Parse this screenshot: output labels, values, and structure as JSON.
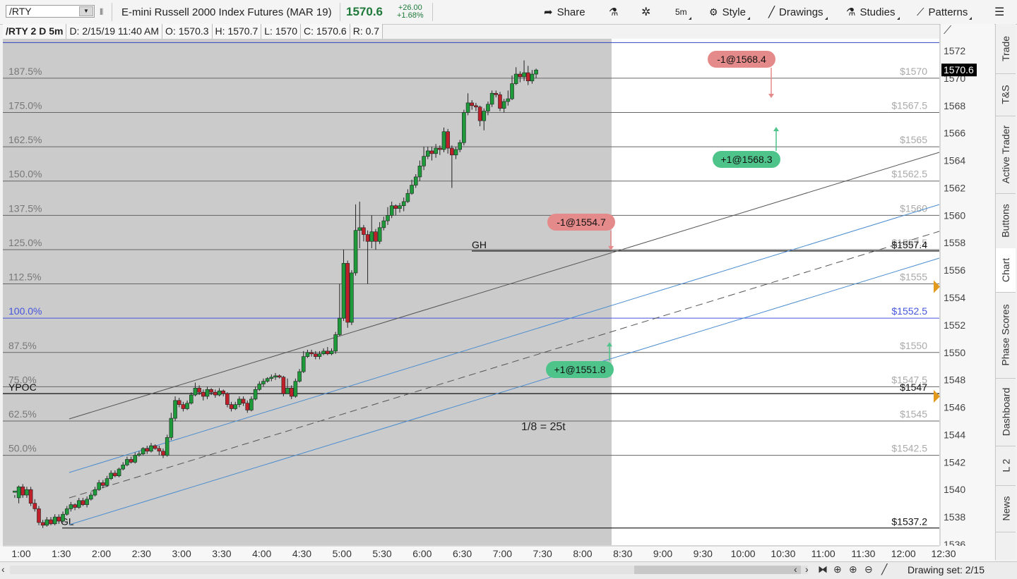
{
  "toolbar": {
    "symbol": "/RTY",
    "description": "E-mini Russell 2000 Index Futures (MAR 19)",
    "last": "1570.6",
    "change": "+26.00",
    "change_pct": "+1.68%",
    "share": "Share",
    "interval": "5m",
    "style": "Style",
    "drawings": "Drawings",
    "studies": "Studies",
    "patterns": "Patterns"
  },
  "infobar": {
    "symbol": "/RTY 2 D 5m",
    "date": "D: 2/15/19 11:40 AM",
    "open": "O: 1570.3",
    "high": "H: 1570.7",
    "low": "L: 1570",
    "close": "C: 1570.6",
    "range": "R: 0.7"
  },
  "chart_data": {
    "type": "candlestick",
    "title": "",
    "x_labels": [
      "1:00",
      "1:30",
      "2:00",
      "2:30",
      "3:00",
      "3:30",
      "4:00",
      "4:30",
      "5:00",
      "5:30",
      "6:00",
      "6:30",
      "7:00",
      "7:30",
      "8:00",
      "8:30",
      "9:00",
      "9:30",
      "10:00",
      "10:30",
      "11:00",
      "11:30",
      "12:00",
      "12:30"
    ],
    "y_ticks": [
      1536,
      1538,
      1540,
      1542,
      1544,
      1546,
      1548,
      1550,
      1552,
      1554,
      1556,
      1558,
      1560,
      1562,
      1564,
      1566,
      1568,
      1570,
      1572
    ],
    "ylim": [
      1535.7,
      1573.3
    ],
    "last_price": "1570.6",
    "levels": [
      {
        "pct": "187.5%",
        "price": "$1570",
        "value": 1570
      },
      {
        "pct": "175.0%",
        "price": "$1567.5",
        "value": 1567.5
      },
      {
        "pct": "162.5%",
        "price": "$1565",
        "value": 1565
      },
      {
        "pct": "150.0%",
        "price": "$1562.5",
        "value": 1562.5
      },
      {
        "pct": "137.5%",
        "price": "$1560",
        "value": 1560
      },
      {
        "pct": "125.0%",
        "price": "$1557.5",
        "value": 1557.5
      },
      {
        "pct": "112.5%",
        "price": "$1555",
        "value": 1555
      },
      {
        "pct": "100.0%",
        "price": "$1552.5",
        "value": 1552.5
      },
      {
        "pct": "87.5%",
        "price": "$1550",
        "value": 1550
      },
      {
        "pct": "75.0%",
        "price": "$1547.5",
        "value": 1547.5
      },
      {
        "pct": "62.5%",
        "price": "$1545",
        "value": 1545
      },
      {
        "pct": "50.0%",
        "price": "$1542.5",
        "value": 1542.5
      }
    ],
    "special_levels": [
      {
        "label": "GH",
        "price": "$1557.4",
        "value": 1557.4
      },
      {
        "label": "YPOC",
        "price": "$1547",
        "value": 1547
      },
      {
        "label": "GL",
        "price": "$1537.2",
        "value": 1537.2
      }
    ],
    "annotation": "1/8 = 25t",
    "trades": [
      {
        "label": "-1@1568.4",
        "side": "sell",
        "t": 10.67,
        "price": 1568.4
      },
      {
        "label": "+1@1568.3",
        "side": "buy",
        "t": 10.75,
        "price": 1566.6
      },
      {
        "label": "-1@1554.7",
        "side": "sell",
        "t": 8.3,
        "price": 1557.3
      },
      {
        "label": "+1@1551.8",
        "side": "buy",
        "t": 8.3,
        "price": 1550.9
      }
    ],
    "candles_compact": "0.92,1539.8,1539.9,1539.6,1539.4 0.97,1539.4,1540.2,1540.3,1539.0 1.02,1540.2,1539.6,1540.4,1539.4 1.07,1539.6,1540.0,1540.2,1539.4 1.12,1540.0,1539.0,1540.2,1538.8 1.17,1539.0,1538.6,1539.3,1538.4 1.22,1538.6,1537.6,1538.8,1537.4 1.27,1537.6,1537.4,1537.8,1537.2 1.32,1537.4,1537.8,1538.0,1537.3 1.37,1537.8,1537.5,1538.0,1537.4 1.42,1537.5,1538.0,1538.2,1537.4 1.47,1538.0,1537.7,1538.2,1537.5 1.52,1537.7,1538.2,1538.4,1537.6 1.57,1538.2,1538.6,1538.8,1538.1 1.62,1538.6,1538.9,1539.1,1538.4 1.67,1538.9,1538.7,1539.0,1538.5 1.72,1538.7,1539.2,1539.4,1538.6 1.77,1539.2,1538.9,1539.4,1538.8 1.82,1538.9,1539.3,1539.5,1538.7 1.87,1539.3,1539.6,1539.8,1539.2 1.92,1539.6,1540.0,1540.2,1539.5 1.97,1540.0,1540.5,1540.7,1539.9 2.02,1540.5,1540.3,1540.7,1540.1 2.07,1540.3,1540.8,1541.0,1540.2 2.12,1540.8,1541.2,1541.4,1540.7 2.17,1541.2,1541.0,1541.4,1540.9 2.22,1541.0,1541.5,1541.6,1540.9 2.27,1541.5,1541.8,1542.0,1541.4 2.32,1541.8,1542.2,1542.4,1541.7 2.37,1542.2,1542.0,1542.4,1541.9 2.42,1542.0,1542.5,1542.7,1541.9 2.47,1542.5,1542.6,1542.8,1542.4 2.52,1542.6,1543.0,1543.1,1542.5 2.57,1543.0,1542.8,1543.2,1542.6 2.62,1542.8,1543.2,1543.4,1542.7 2.67,1543.2,1543.0,1543.3,1542.9 2.72,1543.0,1542.8,1543.2,1542.5 2.77,1542.8,1542.5,1543.0,1542.3 2.82,1542.5,1543.8,1544.0,1542.4 2.87,1543.8,1545.2,1545.6,1543.6 2.92,1545.2,1546.5,1546.8,1545.0 2.97,1546.5,1546.2,1546.7,1546.0 3.02,1546.2,1545.9,1546.4,1545.7 3.07,1545.9,1546.3,1546.5,1545.8 3.12,1546.3,1546.9,1547.1,1546.2 3.17,1546.9,1547.4,1547.8,1546.8 3.22,1547.4,1547.1,1547.6,1546.9 3.27,1547.1,1546.8,1547.3,1546.5 3.32,1546.8,1547.3,1547.5,1546.6 3.37,1547.3,1547.1,1547.4,1546.9 3.42,1547.1,1546.9,1547.3,1546.7 3.47,1546.9,1547.2,1547.4,1546.8 3.52,1547.2,1547.0,1547.3,1546.8 3.57,1547.0,1546.2,1547.1,1546.0 3.62,1546.2,1545.9,1546.4,1545.7 3.67,1545.9,1546.2,1546.4,1545.8 3.72,1546.2,1546.6,1546.8,1546.0 3.77,1546.6,1546.3,1546.8,1546.1 3.82,1546.3,1545.8,1546.5,1545.6 3.87,1545.8,1546.6,1546.8,1545.7 3.92,1546.6,1547.3,1547.5,1546.5 3.97,1547.3,1547.7,1547.9,1547.2 4.02,1547.7,1547.9,1548.1,1547.5 4.07,1547.9,1548.1,1548.2,1547.8 4.12,1548.1,1548.2,1548.4,1547.9 4.17,1548.2,1548.3,1548.5,1548.0 4.22,1548.3,1548.2,1548.4,1548.1 4.27,1548.2,1547.0,1548.3,1546.8 4.32,1547.0,1547.4,1548.1,1547.0 4.37,1547.4,1546.8,1547.6,1546.6 4.42,1546.8,1547.9,1548.1,1546.7 4.47,1547.9,1548.6,1548.8,1547.8 4.52,1548.6,1549.7,1550.1,1548.5 4.57,1549.7,1550.0,1550.2,1549.6 4.62,1550.0,1549.9,1550.2,1549.7 4.67,1549.9,1549.7,1550.1,1549.5 4.72,1549.7,1549.9,1550.1,1549.5 4.77,1549.9,1550.1,1550.3,1549.8 4.82,1550.1,1549.9,1550.4,1549.8 4.87,1549.9,1550.1,1550.3,1549.8 4.92,1550.1,1551.3,1551.5,1549.9 4.97,1551.3,1552.5,1555.0,1551.2 5.02,1552.5,1556.5,1557.5,1552.3 5.07,1556.5,1552.2,1556.7,1551.8 5.12,1552.2,1555.8,1556.0,1552.0 5.17,1555.8,1558.9,1560.8,1555.6 5.22,1558.9,1559.1,1561.0,1557.6 5.27,1559.1,1558.6,1559.3,1558.1 5.32,1558.6,1558.1,1558.9,1555.0 5.37,1558.1,1558.8,1560.0,1557.6 5.42,1558.8,1558.1,1559.0,1557.5 5.47,1558.1,1559.1,1559.5,1557.9 5.52,1559.1,1559.6,1559.9,1558.9 5.57,1559.6,1560.0,1560.6,1559.3 5.62,1560.0,1560.7,1561.0,1559.8 5.67,1560.7,1560.5,1560.8,1560.0 5.72,1560.5,1560.7,1560.9,1560.2 5.77,1560.7,1561.0,1561.3,1560.3 5.82,1561.0,1561.6,1561.9,1560.9 5.87,1561.6,1562.2,1562.6,1561.5 5.92,1562.2,1562.8,1563.0,1562.0 5.97,1562.8,1563.6,1564.0,1562.5 6.02,1563.6,1564.3,1565.0,1563.3 6.07,1564.3,1564.7,1565.0,1564.1 6.12,1564.7,1564.5,1565.0,1564.0 6.17,1564.5,1564.9,1565.2,1564.2 6.22,1564.9,1564.8,1565.1,1564.4 6.27,1564.8,1566.1,1566.4,1564.6 6.32,1566.1,1564.9,1566.3,1564.5 6.37,1564.9,1564.4,1565.1,1562.0 6.42,1564.4,1564.8,1565.0,1564.1 6.47,1564.8,1565.3,1565.5,1564.6 6.52,1565.3,1567.5,1567.7,1565.1 6.57,1567.5,1568.2,1568.9,1567.3 6.62,1568.2,1568.0,1568.4,1567.7 6.67,1568.0,1567.9,1568.2,1567.6 6.72,1567.9,1566.9,1568.0,1566.5 6.77,1566.9,1567.6,1567.8,1566.2 6.82,1567.6,1568.1,1568.3,1567.3 6.87,1568.1,1568.9,1569.1,1567.9 6.92,1568.9,1568.8,1569.1,1568.6 6.97,1568.8,1567.8,1569.0,1567.6 7.02,1567.8,1568.3,1568.5,1567.5 7.07,1568.3,1568.5,1569.1,1568.0 7.12,1568.5,1569.6,1570.2,1568.4 7.17,1569.6,1570.3,1570.8,1569.5 7.22,1570.3,1570.1,1570.5,1569.7 7.27,1570.1,1570.4,1571.3,1569.8 7.32,1570.4,1569.8,1570.9,1569.5 7.37,1569.8,1570.3,1570.6,1569.6 7.42,1570.3,1570.6,1570.7,1570.0"
  }
}
